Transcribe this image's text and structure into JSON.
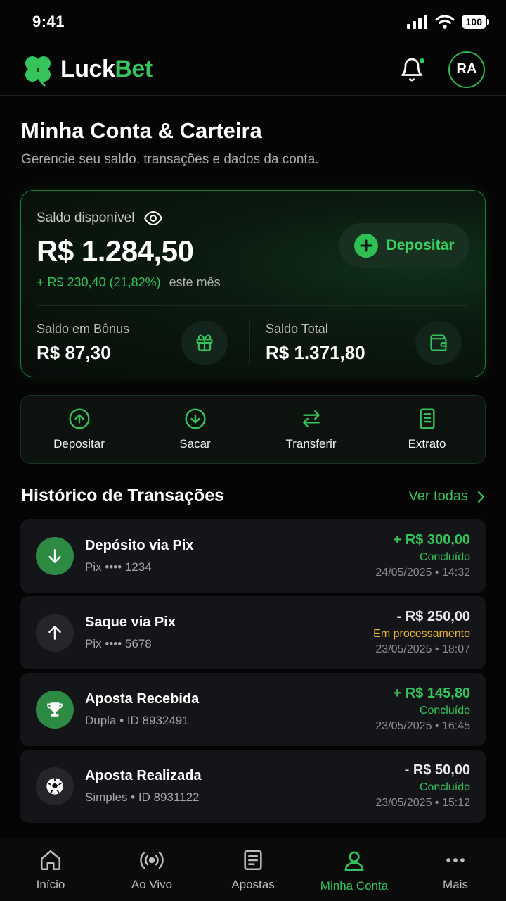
{
  "status_bar": {
    "time": "9:41",
    "battery": "100"
  },
  "header": {
    "brand_main": "Luck",
    "brand_accent": "Bet",
    "avatar_initials": "RA"
  },
  "page": {
    "title": "Minha Conta & Carteira",
    "subtitle": "Gerencie seu saldo, transações e dados da conta."
  },
  "balance": {
    "label": "Saldo disponível",
    "amount": "R$ 1.284,50",
    "change": "+ R$ 230,40 (21,82%)",
    "change_period": "este mês",
    "deposit_label": "Depositar",
    "bonus_label": "Saldo em Bônus",
    "bonus_value": "R$ 87,30",
    "total_label": "Saldo Total",
    "total_value": "R$ 1.371,80"
  },
  "actions": [
    {
      "label": "Depositar",
      "icon": "arrow-up-circle-icon"
    },
    {
      "label": "Sacar",
      "icon": "arrow-down-circle-icon"
    },
    {
      "label": "Transferir",
      "icon": "transfer-icon"
    },
    {
      "label": "Extrato",
      "icon": "document-icon"
    }
  ],
  "history": {
    "title": "Histórico de Transações",
    "see_all": "Ver todas",
    "items": [
      {
        "title": "Depósito via Pix",
        "sub": "Pix •••• 1234",
        "amount": "+ R$ 300,00",
        "status": "Concluído",
        "date": "24/05/2025 • 14:32",
        "icon": "arrow-down-icon"
      },
      {
        "title": "Saque via Pix",
        "sub": "Pix •••• 5678",
        "amount": "- R$ 250,00",
        "status": "Em processamento",
        "date": "23/05/2025 • 18:07",
        "icon": "arrow-up-icon"
      },
      {
        "title": "Aposta Recebida",
        "sub": "Dupla • ID 8932491",
        "amount": "+ R$ 145,80",
        "status": "Concluído",
        "date": "23/05/2025 • 16:45",
        "icon": "trophy-icon"
      },
      {
        "title": "Aposta Realizada",
        "sub": "Simples • ID 8931122",
        "amount": "- R$ 50,00",
        "status": "Concluído",
        "date": "23/05/2025 • 15:12",
        "icon": "soccer-ball-icon"
      }
    ]
  },
  "nav": [
    {
      "label": "Início",
      "icon": "home-icon"
    },
    {
      "label": "Ao Vivo",
      "icon": "live-icon"
    },
    {
      "label": "Apostas",
      "icon": "bets-icon"
    },
    {
      "label": "Minha Conta",
      "icon": "user-icon",
      "active": true
    },
    {
      "label": "Mais",
      "icon": "more-icon"
    }
  ],
  "colors": {
    "accent": "#35c45b",
    "pending": "#e9b52b",
    "background": "#050505"
  }
}
